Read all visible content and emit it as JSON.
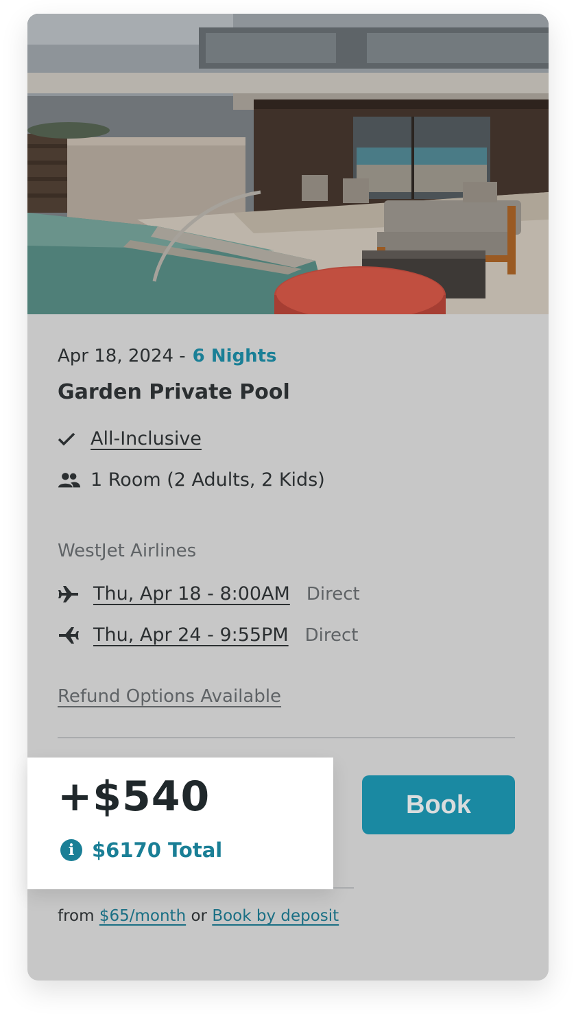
{
  "listing": {
    "date": "Apr 18, 2024 -",
    "nights": "6 Nights",
    "room_title": "Garden Private Pool",
    "features": [
      {
        "icon": "check-icon",
        "label": "All-Inclusive"
      },
      {
        "icon": "people-icon",
        "label": "1 Room (2 Adults, 2 Kids)"
      }
    ]
  },
  "flights": {
    "airline": "WestJet Airlines",
    "legs": [
      {
        "icon": "plane-departure-icon",
        "time": "Thu, Apr 18 - 8:00AM",
        "type": "Direct"
      },
      {
        "icon": "plane-return-icon",
        "time": "Thu, Apr 24 - 9:55PM",
        "type": "Direct"
      }
    ]
  },
  "refund_label": "Refund Options Available",
  "pricing": {
    "price": "+$540",
    "total": "$6170 Total",
    "info_icon": "i"
  },
  "book_button": "Book",
  "finance": {
    "prefix": "from",
    "monthly": "$65/month",
    "or": "or",
    "deposit": "Book by deposit"
  },
  "colors": {
    "accent": "#1a7f96",
    "button": "#1a89a2",
    "card_overlay": "#c7c7c7",
    "text_dark": "#2b2f31"
  }
}
